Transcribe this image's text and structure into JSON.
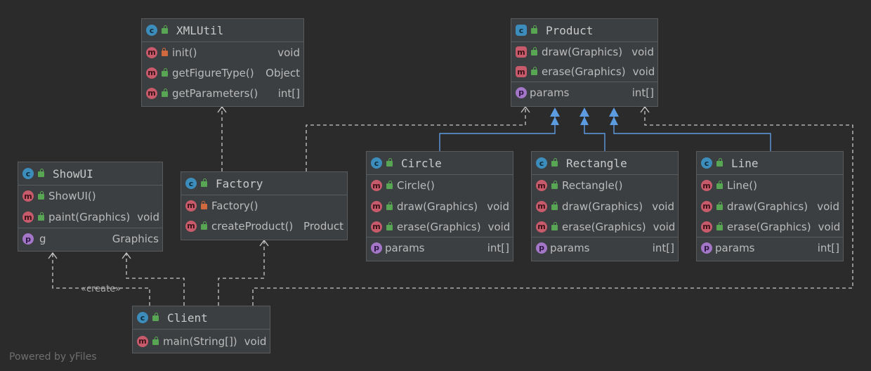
{
  "classes": {
    "xmlutil": {
      "name": "XMLUtil",
      "members": [
        {
          "kind": "m",
          "vis": "prv",
          "sig": "init()",
          "ret": "void"
        },
        {
          "kind": "m",
          "vis": "pub",
          "sig": "getFigureType()",
          "ret": "Object"
        },
        {
          "kind": "m",
          "vis": "pub",
          "sig": "getParameters()",
          "ret": "int[]"
        }
      ]
    },
    "product": {
      "name": "Product",
      "methods": [
        {
          "kind": "m",
          "vis": "pub",
          "sig": "draw(Graphics)",
          "ret": "void"
        },
        {
          "kind": "m",
          "vis": "pub",
          "sig": "erase(Graphics)",
          "ret": "void"
        }
      ],
      "fields": [
        {
          "kind": "p",
          "sig": "params",
          "ret": "int[]"
        }
      ]
    },
    "showui": {
      "name": "ShowUI",
      "methods": [
        {
          "kind": "m",
          "vis": "pub",
          "sig": "ShowUI()",
          "ret": ""
        },
        {
          "kind": "m",
          "vis": "pub",
          "sig": "paint(Graphics)",
          "ret": "void"
        }
      ],
      "fields": [
        {
          "kind": "p",
          "sig": "g",
          "ret": "Graphics"
        }
      ]
    },
    "factory": {
      "name": "Factory",
      "members": [
        {
          "kind": "m",
          "vis": "prv",
          "sig": "Factory()",
          "ret": ""
        },
        {
          "kind": "m",
          "vis": "pub",
          "sig": "createProduct()",
          "ret": "Product"
        }
      ]
    },
    "circle": {
      "name": "Circle",
      "methods": [
        {
          "kind": "m",
          "vis": "pub",
          "sig": "Circle()",
          "ret": ""
        },
        {
          "kind": "m",
          "vis": "pub",
          "sig": "draw(Graphics)",
          "ret": "void"
        },
        {
          "kind": "m",
          "vis": "pub",
          "sig": "erase(Graphics)",
          "ret": "void"
        }
      ],
      "fields": [
        {
          "kind": "p",
          "sig": "params",
          "ret": "int[]"
        }
      ]
    },
    "rectangle": {
      "name": "Rectangle",
      "methods": [
        {
          "kind": "m",
          "vis": "pub",
          "sig": "Rectangle()",
          "ret": ""
        },
        {
          "kind": "m",
          "vis": "pub",
          "sig": "draw(Graphics)",
          "ret": "void"
        },
        {
          "kind": "m",
          "vis": "pub",
          "sig": "erase(Graphics)",
          "ret": "void"
        }
      ],
      "fields": [
        {
          "kind": "p",
          "sig": "params",
          "ret": "int[]"
        }
      ]
    },
    "line": {
      "name": "Line",
      "methods": [
        {
          "kind": "m",
          "vis": "pub",
          "sig": "Line()",
          "ret": ""
        },
        {
          "kind": "m",
          "vis": "pub",
          "sig": "draw(Graphics)",
          "ret": "void"
        },
        {
          "kind": "m",
          "vis": "pub",
          "sig": "erase(Graphics)",
          "ret": "void"
        }
      ],
      "fields": [
        {
          "kind": "p",
          "sig": "params",
          "ret": "int[]"
        }
      ]
    },
    "client": {
      "name": "Client",
      "members": [
        {
          "kind": "m",
          "vis": "pub",
          "sig": "main(String[])",
          "ret": "void"
        }
      ]
    }
  },
  "labels": {
    "create_stereotype": "«create»",
    "powered_by": "Powered by yFiles"
  },
  "icons": {
    "class": "c",
    "method": "m",
    "property": "p"
  },
  "colors": {
    "background": "#2b2b2b",
    "node_fill": "#3c3f41",
    "node_border": "#595b5d",
    "dependency_line": "#c8c8c8",
    "inheritance_line": "#5d9be0",
    "class_icon": "#3c8dbc",
    "method_icon": "#c75b6b",
    "property_icon": "#a376c8",
    "public": "#58a653",
    "private": "#d1693f"
  }
}
